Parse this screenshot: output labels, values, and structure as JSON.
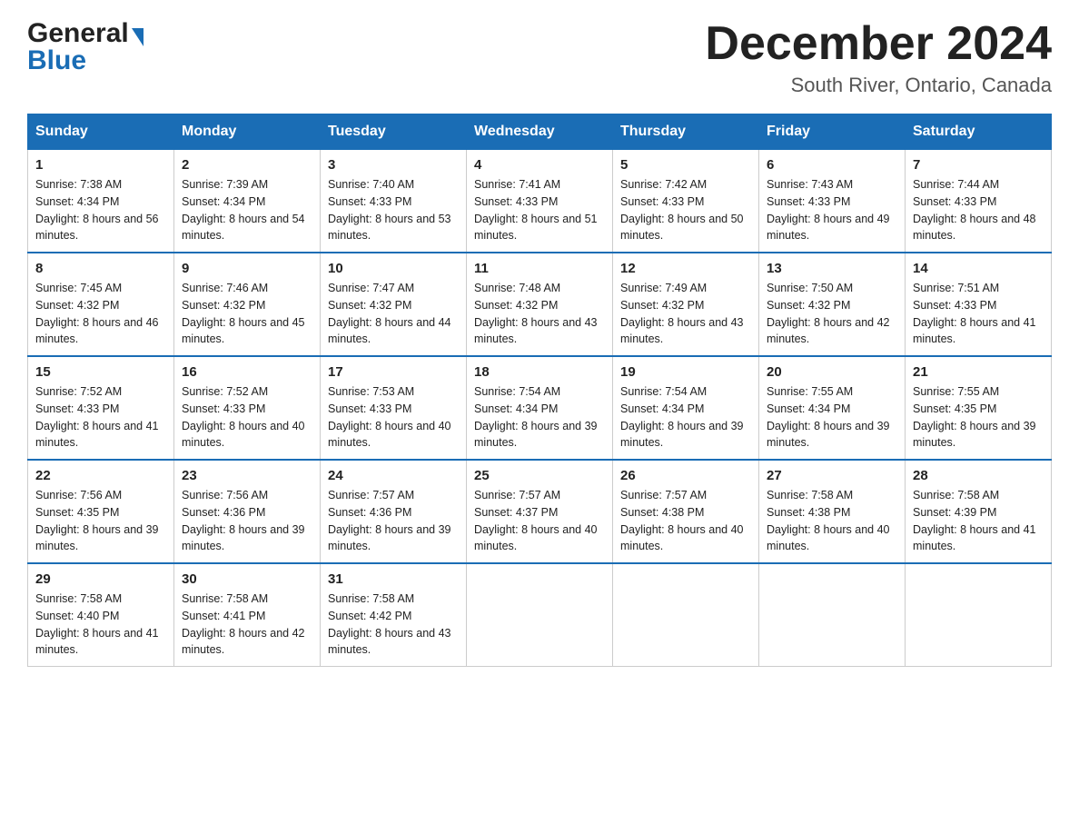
{
  "header": {
    "logo_general": "General",
    "logo_blue": "Blue",
    "month_title": "December 2024",
    "location": "South River, Ontario, Canada"
  },
  "days_of_week": [
    "Sunday",
    "Monday",
    "Tuesday",
    "Wednesday",
    "Thursday",
    "Friday",
    "Saturday"
  ],
  "weeks": [
    [
      {
        "day": "1",
        "sunrise": "7:38 AM",
        "sunset": "4:34 PM",
        "daylight": "8 hours and 56 minutes."
      },
      {
        "day": "2",
        "sunrise": "7:39 AM",
        "sunset": "4:34 PM",
        "daylight": "8 hours and 54 minutes."
      },
      {
        "day": "3",
        "sunrise": "7:40 AM",
        "sunset": "4:33 PM",
        "daylight": "8 hours and 53 minutes."
      },
      {
        "day": "4",
        "sunrise": "7:41 AM",
        "sunset": "4:33 PM",
        "daylight": "8 hours and 51 minutes."
      },
      {
        "day": "5",
        "sunrise": "7:42 AM",
        "sunset": "4:33 PM",
        "daylight": "8 hours and 50 minutes."
      },
      {
        "day": "6",
        "sunrise": "7:43 AM",
        "sunset": "4:33 PM",
        "daylight": "8 hours and 49 minutes."
      },
      {
        "day": "7",
        "sunrise": "7:44 AM",
        "sunset": "4:33 PM",
        "daylight": "8 hours and 48 minutes."
      }
    ],
    [
      {
        "day": "8",
        "sunrise": "7:45 AM",
        "sunset": "4:32 PM",
        "daylight": "8 hours and 46 minutes."
      },
      {
        "day": "9",
        "sunrise": "7:46 AM",
        "sunset": "4:32 PM",
        "daylight": "8 hours and 45 minutes."
      },
      {
        "day": "10",
        "sunrise": "7:47 AM",
        "sunset": "4:32 PM",
        "daylight": "8 hours and 44 minutes."
      },
      {
        "day": "11",
        "sunrise": "7:48 AM",
        "sunset": "4:32 PM",
        "daylight": "8 hours and 43 minutes."
      },
      {
        "day": "12",
        "sunrise": "7:49 AM",
        "sunset": "4:32 PM",
        "daylight": "8 hours and 43 minutes."
      },
      {
        "day": "13",
        "sunrise": "7:50 AM",
        "sunset": "4:32 PM",
        "daylight": "8 hours and 42 minutes."
      },
      {
        "day": "14",
        "sunrise": "7:51 AM",
        "sunset": "4:33 PM",
        "daylight": "8 hours and 41 minutes."
      }
    ],
    [
      {
        "day": "15",
        "sunrise": "7:52 AM",
        "sunset": "4:33 PM",
        "daylight": "8 hours and 41 minutes."
      },
      {
        "day": "16",
        "sunrise": "7:52 AM",
        "sunset": "4:33 PM",
        "daylight": "8 hours and 40 minutes."
      },
      {
        "day": "17",
        "sunrise": "7:53 AM",
        "sunset": "4:33 PM",
        "daylight": "8 hours and 40 minutes."
      },
      {
        "day": "18",
        "sunrise": "7:54 AM",
        "sunset": "4:34 PM",
        "daylight": "8 hours and 39 minutes."
      },
      {
        "day": "19",
        "sunrise": "7:54 AM",
        "sunset": "4:34 PM",
        "daylight": "8 hours and 39 minutes."
      },
      {
        "day": "20",
        "sunrise": "7:55 AM",
        "sunset": "4:34 PM",
        "daylight": "8 hours and 39 minutes."
      },
      {
        "day": "21",
        "sunrise": "7:55 AM",
        "sunset": "4:35 PM",
        "daylight": "8 hours and 39 minutes."
      }
    ],
    [
      {
        "day": "22",
        "sunrise": "7:56 AM",
        "sunset": "4:35 PM",
        "daylight": "8 hours and 39 minutes."
      },
      {
        "day": "23",
        "sunrise": "7:56 AM",
        "sunset": "4:36 PM",
        "daylight": "8 hours and 39 minutes."
      },
      {
        "day": "24",
        "sunrise": "7:57 AM",
        "sunset": "4:36 PM",
        "daylight": "8 hours and 39 minutes."
      },
      {
        "day": "25",
        "sunrise": "7:57 AM",
        "sunset": "4:37 PM",
        "daylight": "8 hours and 40 minutes."
      },
      {
        "day": "26",
        "sunrise": "7:57 AM",
        "sunset": "4:38 PM",
        "daylight": "8 hours and 40 minutes."
      },
      {
        "day": "27",
        "sunrise": "7:58 AM",
        "sunset": "4:38 PM",
        "daylight": "8 hours and 40 minutes."
      },
      {
        "day": "28",
        "sunrise": "7:58 AM",
        "sunset": "4:39 PM",
        "daylight": "8 hours and 41 minutes."
      }
    ],
    [
      {
        "day": "29",
        "sunrise": "7:58 AM",
        "sunset": "4:40 PM",
        "daylight": "8 hours and 41 minutes."
      },
      {
        "day": "30",
        "sunrise": "7:58 AM",
        "sunset": "4:41 PM",
        "daylight": "8 hours and 42 minutes."
      },
      {
        "day": "31",
        "sunrise": "7:58 AM",
        "sunset": "4:42 PM",
        "daylight": "8 hours and 43 minutes."
      },
      null,
      null,
      null,
      null
    ]
  ],
  "labels": {
    "sunrise": "Sunrise:",
    "sunset": "Sunset:",
    "daylight": "Daylight:"
  }
}
